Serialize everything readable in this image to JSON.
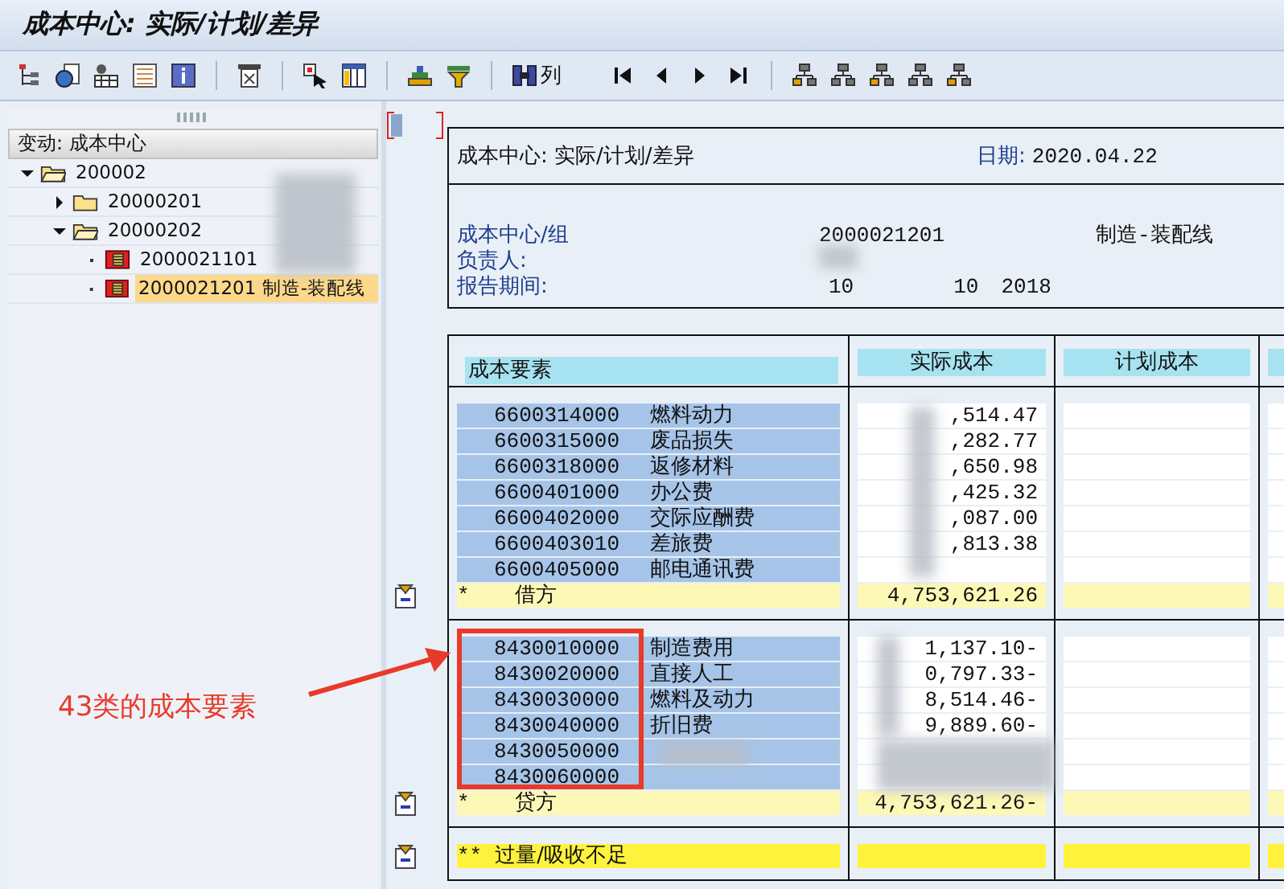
{
  "window": {
    "title": "成本中心: 实际/计划/差异"
  },
  "toolbar": {
    "column_button": "列"
  },
  "tree": {
    "header": "变动: 成本中心",
    "items": [
      {
        "label": "200002",
        "kind": "folder",
        "expanded": true,
        "selected": false,
        "children": [
          {
            "label": "20000201",
            "kind": "folder",
            "expanded": false,
            "selected": false
          },
          {
            "label": "20000202",
            "kind": "folder",
            "expanded": true,
            "selected": false,
            "children": [
              {
                "label": "2000021101",
                "kind": "leaf",
                "selected": false
              },
              {
                "label": "2000021201 制造-装配线",
                "kind": "leaf",
                "selected": true
              }
            ]
          }
        ]
      }
    ]
  },
  "report": {
    "title": "成本中心: 实际/计划/差异",
    "date_label": "日期:",
    "date": "2020.04.22",
    "fields": [
      {
        "label": "成本中心/组",
        "values": [
          "2000021201",
          "制造-装配线"
        ]
      },
      {
        "label": "负责人:"
      },
      {
        "label": "报告期间:",
        "values": [
          "10",
          "10",
          "2018"
        ]
      }
    ]
  },
  "table": {
    "columns": [
      "成本要素",
      "实际成本",
      "计划成本"
    ],
    "sections": [
      {
        "rows": [
          {
            "code": "6600314000",
            "name": "燃料动力",
            "actual": ",514.47"
          },
          {
            "code": "6600315000",
            "name": "废品损失",
            "actual": ",282.77"
          },
          {
            "code": "6600318000",
            "name": "返修材料",
            "actual": ",650.98"
          },
          {
            "code": "6600401000",
            "name": "办公费",
            "actual": ",425.32"
          },
          {
            "code": "6600402000",
            "name": "交际应酬费",
            "actual": ",087.00"
          },
          {
            "code": "6600403010",
            "name": "差旅费",
            "actual": ",813.38"
          },
          {
            "code": "6600405000",
            "name": "邮电通讯费"
          }
        ],
        "total": {
          "kind": "subtotal",
          "marker": "*",
          "label": "借方",
          "actual": "4,753,621.26"
        }
      },
      {
        "rows": [
          {
            "code": "8430010000",
            "name": "制造费用",
            "actual": "1,137.10-"
          },
          {
            "code": "8430020000",
            "name": "直接人工",
            "actual": "0,797.33-"
          },
          {
            "code": "8430030000",
            "name": "燃料及动力",
            "actual": "8,514.46-"
          },
          {
            "code": "8430040000",
            "name": "折旧费",
            "actual": "9,889.60-"
          },
          {
            "code": "8430050000"
          },
          {
            "code": "8430060000"
          }
        ],
        "total": {
          "kind": "subtotal",
          "marker": "*",
          "label": "贷方",
          "actual": "4,753,621.26-"
        }
      },
      {
        "total": {
          "kind": "grand",
          "marker": "**",
          "label": "过量/吸收不足"
        }
      }
    ]
  },
  "annotation": {
    "text": "43类的成本要素"
  }
}
